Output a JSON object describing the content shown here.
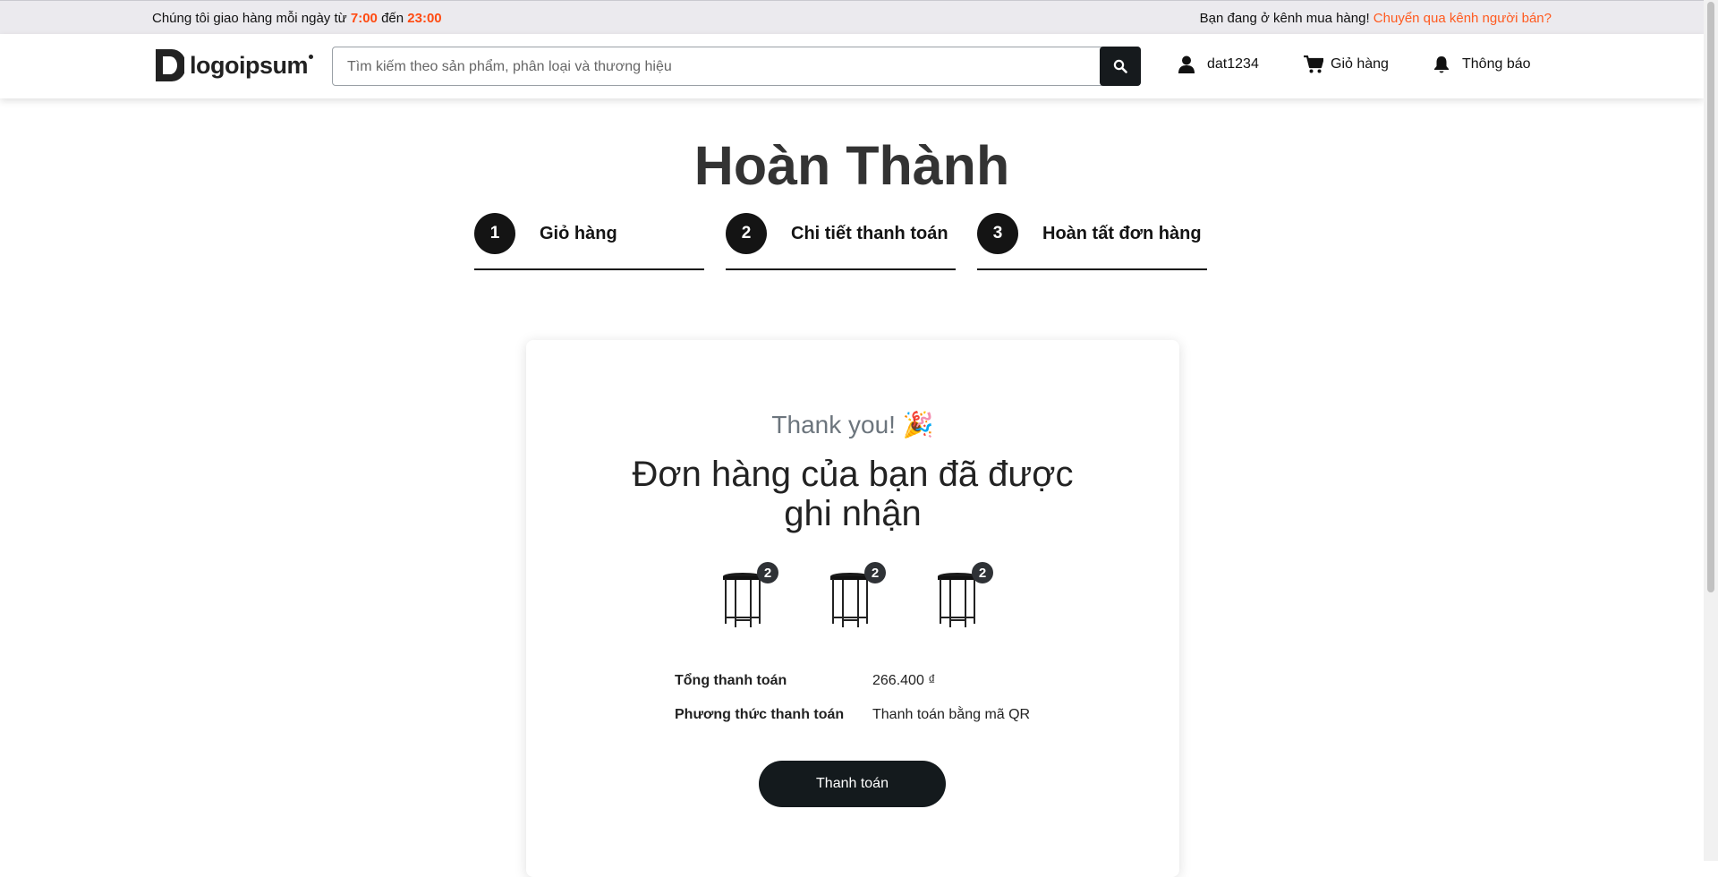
{
  "topbar": {
    "delivery_prefix": "Chúng tôi giao hàng mỗi ngày từ",
    "time_start": "7:00",
    "delivery_mid": "đến",
    "time_end": "23:00",
    "channel_text": "Bạn đang ở kênh mua hàng!",
    "switch_link": "Chuyển qua kênh người bán?"
  },
  "header": {
    "logo_text": "logoipsum",
    "search_placeholder": "Tìm kiếm theo sản phẩm, phân loại và thương hiệu",
    "search_value": "",
    "user_label": "dat1234",
    "cart_label": "Giỏ hàng",
    "notify_label": "Thông báo",
    "icons": {
      "search": "search-icon",
      "user": "user-icon",
      "cart": "cart-icon",
      "bell": "bell-icon"
    }
  },
  "page": {
    "title": "Hoàn Thành",
    "steps": [
      {
        "num": "1",
        "label": "Giỏ hàng"
      },
      {
        "num": "2",
        "label": "Chi tiết thanh toán"
      },
      {
        "num": "3",
        "label": "Hoàn tất đơn hàng"
      }
    ]
  },
  "order": {
    "thanks": "Thank you! 🎉",
    "headline": "Đơn hàng của bạn đã được ghi nhận",
    "products": [
      {
        "qty": "2",
        "icon": "side-table-icon"
      },
      {
        "qty": "2",
        "icon": "side-table-icon"
      },
      {
        "qty": "2",
        "icon": "side-table-icon"
      }
    ],
    "total_label": "Tổng thanh toán",
    "total_value": "266.400 ₫",
    "method_label": "Phương thức thanh toán",
    "method_value": "Thanh toán bằng mã QR",
    "pay_button": "Thanh toán"
  },
  "colors": {
    "accent": "#ff4b12",
    "dark": "#141a1d",
    "topbar_bg": "#ebeaee"
  }
}
